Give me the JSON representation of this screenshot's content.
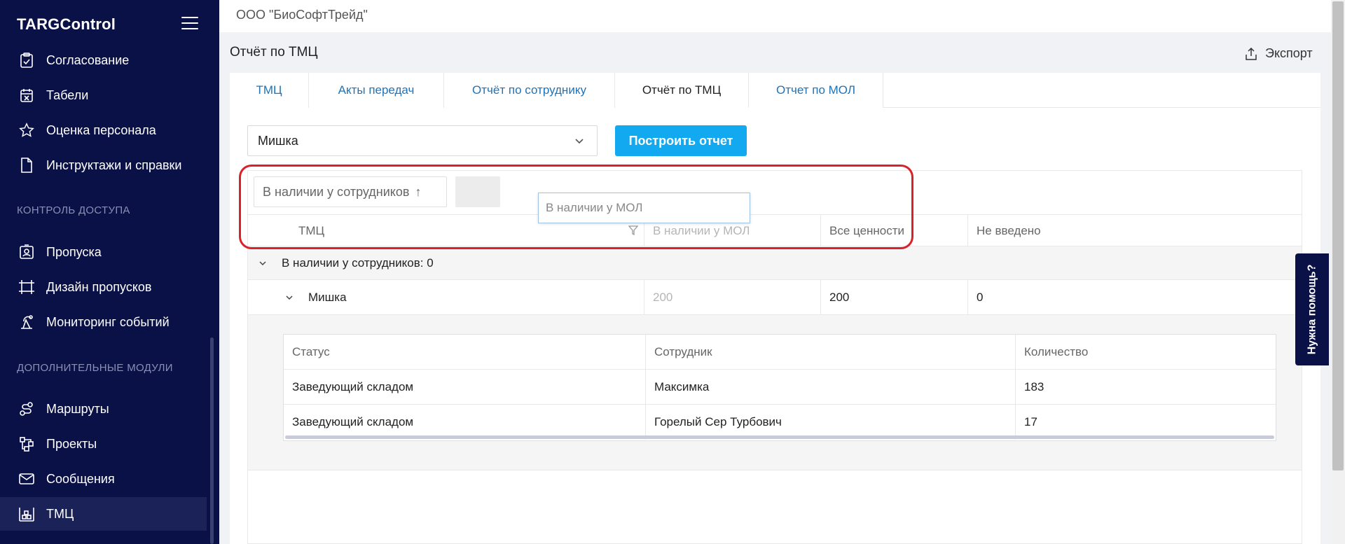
{
  "sidebar": {
    "brand": "TARGControl",
    "items": [
      {
        "label": "Согласование",
        "icon": "clipboard-check-icon"
      },
      {
        "label": "Табели",
        "icon": "calendar-x-icon"
      },
      {
        "label": "Оценка персонала",
        "icon": "star-icon"
      },
      {
        "label": "Инструктажи и справки",
        "icon": "document-icon"
      }
    ],
    "section_access": "КОНТРОЛЬ ДОСТУПА",
    "access_items": [
      {
        "label": "Пропуска",
        "icon": "id-card-icon"
      },
      {
        "label": "Дизайн пропусков",
        "icon": "design-icon"
      },
      {
        "label": "Мониторинг событий",
        "icon": "monitoring-icon"
      }
    ],
    "section_modules": "ДОПОЛНИТЕЛЬНЫЕ МОДУЛИ",
    "module_items": [
      {
        "label": "Маршруты",
        "icon": "route-icon"
      },
      {
        "label": "Проекты",
        "icon": "projects-icon"
      },
      {
        "label": "Сообщения",
        "icon": "mail-icon"
      },
      {
        "label": "ТМЦ",
        "icon": "warehouse-icon",
        "active": true
      }
    ]
  },
  "topbar": {
    "org": "ООО \"БиоСофтТрейд\""
  },
  "page": {
    "title": "Отчёт по ТМЦ",
    "export_label": "Экспорт"
  },
  "tabs": [
    {
      "label": "ТМЦ"
    },
    {
      "label": "Акты передач"
    },
    {
      "label": "Отчёт по сотруднику"
    },
    {
      "label": "Отчёт по ТМЦ",
      "active": true
    },
    {
      "label": "Отчет по МОЛ"
    }
  ],
  "filter": {
    "selected": "Мишка",
    "build_button": "Построить отчет"
  },
  "grid": {
    "group_chip": "В наличии у сотрудников",
    "group_chip_arrow": "↑",
    "drag_ghost": "В наличии у МОЛ",
    "columns": [
      "ТМЦ",
      "В наличии у МОЛ",
      "Все ценности",
      "Не введено"
    ],
    "group_row": "В наличии у сотрудников: 0",
    "row": {
      "name": "Мишка",
      "mol": "200",
      "all": "200",
      "not_entered": "0"
    },
    "detail": {
      "columns": [
        "Статус",
        "Сотрудник",
        "Количество"
      ],
      "rows": [
        [
          "Заведующий складом",
          "Максимка",
          "183"
        ],
        [
          "Заведующий складом",
          "Горелый Сер Турбович",
          "17"
        ]
      ]
    }
  },
  "help": {
    "label": "Нужна помощь?"
  },
  "colors": {
    "sidebar": "#0a1146",
    "accent": "#12a9f0",
    "link": "#1f73b7",
    "highlight": "#d8222a"
  }
}
